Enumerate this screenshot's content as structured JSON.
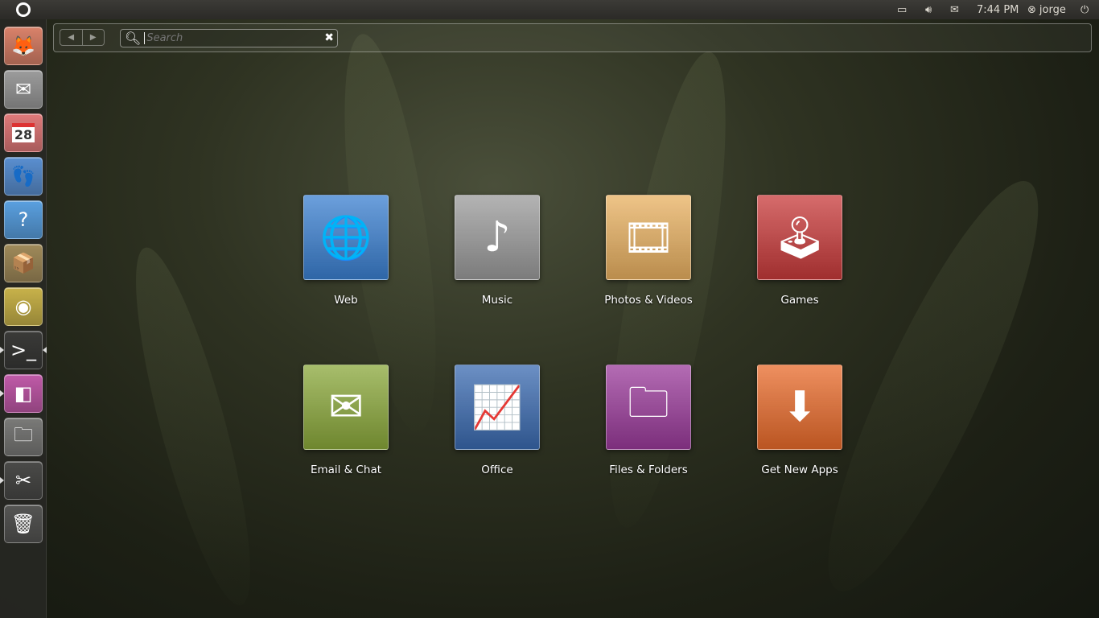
{
  "panel": {
    "time": "7:44 PM",
    "user": "jorge",
    "indicators": [
      "battery-icon",
      "volume-icon",
      "mail-icon",
      "user-status-icon",
      "power-icon"
    ]
  },
  "launcher": {
    "items": [
      {
        "name": "firefox",
        "icon": "firefox-icon",
        "color": "#d9826a"
      },
      {
        "name": "mail",
        "icon": "mail-icon",
        "color": "#9c9c9c"
      },
      {
        "name": "calendar",
        "icon": "calendar-icon",
        "color": "#e07a7a",
        "text": "28"
      },
      {
        "name": "empathy",
        "icon": "chat-icon",
        "color": "#5a8fd0"
      },
      {
        "name": "help",
        "icon": "help-icon",
        "color": "#5aa0e0"
      },
      {
        "name": "software-center",
        "icon": "package-icon",
        "color": "#a08a5a"
      },
      {
        "name": "speaker",
        "icon": "speaker-icon",
        "color": "#c8b24a"
      },
      {
        "name": "terminal",
        "icon": "terminal-icon",
        "color": "#3a3a38"
      },
      {
        "name": "workspaces",
        "icon": "workspace-switcher-icon",
        "color": "#c05aa8"
      },
      {
        "name": "files",
        "icon": "folder-icon",
        "color": "#7a7a78"
      },
      {
        "name": "system-tools",
        "icon": "tools-icon",
        "color": "#4a4a48"
      },
      {
        "name": "trash",
        "icon": "trash-icon",
        "color": "#555553"
      }
    ]
  },
  "dash": {
    "search_placeholder": "Search",
    "back": "◀",
    "forward": "▶",
    "clear": "✖"
  },
  "apps": [
    {
      "label": "Web",
      "icon": "globe-icon",
      "color": "#3a7fd0"
    },
    {
      "label": "Music",
      "icon": "music-icon",
      "color": "#9a9a9a"
    },
    {
      "label": "Photos & Videos",
      "icon": "photos-icon",
      "color": "#e8b060"
    },
    {
      "label": "Games",
      "icon": "joystick-icon",
      "color": "#c83a3a"
    },
    {
      "label": "Email & Chat",
      "icon": "email-chat-icon",
      "color": "#8aa83a"
    },
    {
      "label": "Office",
      "icon": "office-chart-icon",
      "color": "#3a6ab0"
    },
    {
      "label": "Files & Folders",
      "icon": "folder-icon",
      "color": "#9a3a9a"
    },
    {
      "label": "Get New Apps",
      "icon": "download-icon",
      "color": "#e86a2a"
    }
  ]
}
